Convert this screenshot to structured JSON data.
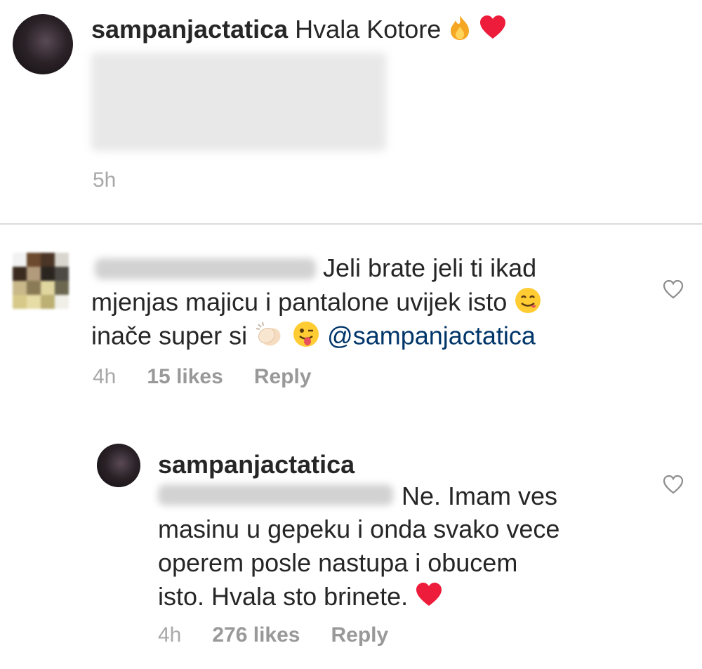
{
  "comments": [
    {
      "username": "sampanjactatica",
      "text": "Hvala Kotore",
      "time": "5h"
    },
    {
      "text_lines": [
        "Jeli brate jeli ti ikad",
        "mjenjas majicu i pantalone uvijek isto",
        "inače super si"
      ],
      "mention": "@sampanjactatica",
      "time": "4h",
      "likes": "15 likes",
      "reply_label": "Reply"
    },
    {
      "username": "sampanjactatica",
      "text_lines": [
        "Ne. Imam ves",
        "masinu u gepeku i onda svako vece",
        "operem posle nastupa i obucem",
        "isto. Hvala sto brinete."
      ],
      "time": "4h",
      "likes": "276 likes",
      "reply_label": "Reply"
    }
  ],
  "colors": {
    "text": "#262626",
    "meta": "#999999",
    "mention": "#003569",
    "heart_red": "#ed1c3b"
  },
  "icons": [
    "fire-emoji",
    "red-heart-emoji",
    "yum-face-emoji",
    "clapping-hands-emoji",
    "winking-tongue-emoji",
    "like-heart-icon"
  ]
}
